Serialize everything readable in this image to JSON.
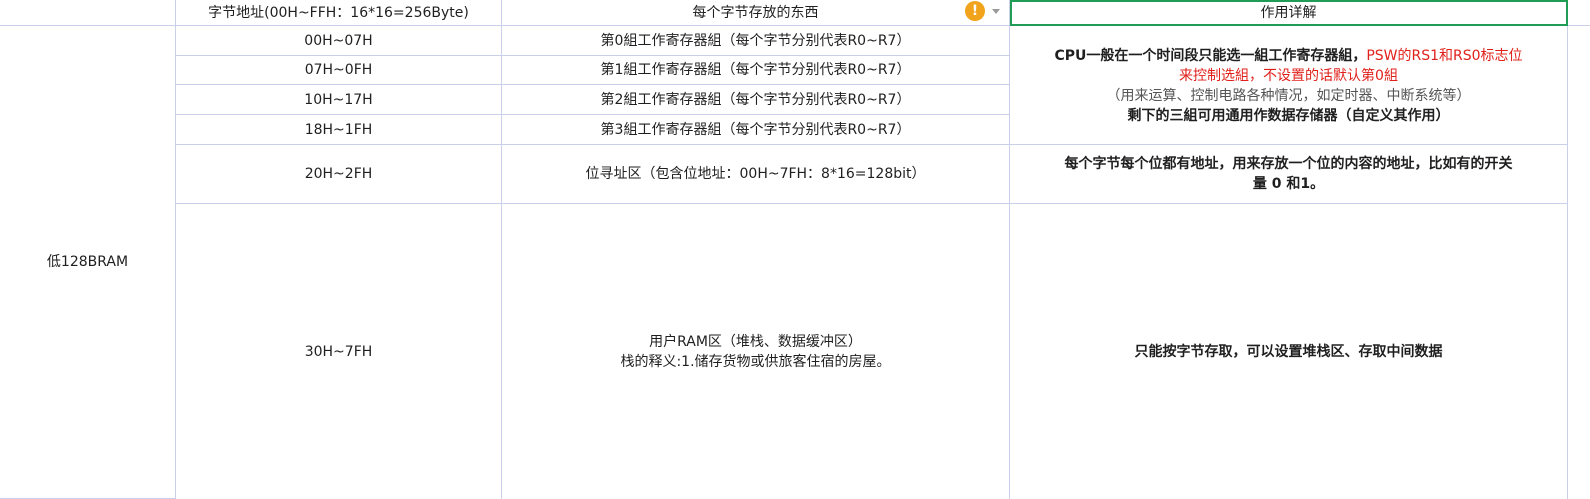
{
  "header": {
    "col_b": "字节地址(00H~FFH：16*16=256Byte)",
    "col_c": "每个字节存放的东西",
    "col_d": "作用详解",
    "warning_icon": "!"
  },
  "region_label": "低128BRAM",
  "rows": [
    {
      "addr": "00H~07H",
      "content": "第0組工作寄存器組（每个字节分别代表R0~R7）"
    },
    {
      "addr": "07H~0FH",
      "content": "第1組工作寄存器組（每个字节分别代表R0~R7）"
    },
    {
      "addr": "10H~17H",
      "content": "第2組工作寄存器組（每个字节分别代表R0~R7）"
    },
    {
      "addr": "18H~1FH",
      "content": "第3組工作寄存器組（每个字节分别代表R0~R7）"
    },
    {
      "addr": "20H~2FH",
      "content": "位寻址区（包含位地址：00H~7FH：8*16=128bit）"
    },
    {
      "addr": "30H~7FH",
      "content_line1": "用户RAM区（堆栈、数据缓冲区）",
      "content_line2": "栈的释义:1.储存货物或供旅客住宿的房屋。"
    }
  ],
  "details": {
    "registers": {
      "line1_black": "CPU一般在一个时间段只能选一組工作寄存器組，",
      "line1_red": "PSW的RS1和RS0标志位",
      "line2_red": "来控制选組，不设置的话默认第0組",
      "line3_gray": "（用来运算、控制电路各种情况，如定时器、中断系统等）",
      "line4": "剩下的三組可用通用作数据存储器（自定义其作用）"
    },
    "bit_area": {
      "line1": "每个字节每个位都有地址，用来存放一个位的内容的地址，比如有的开关",
      "line2": "量 0 和1。"
    },
    "user_ram": "只能按字节存取，可以设置堆栈区、存取中间数据"
  },
  "colors": {
    "grid_line": "#c9cfe8",
    "selection": "#1f9d55",
    "red_text": "#e0211b",
    "warning": "#f0a31b"
  }
}
